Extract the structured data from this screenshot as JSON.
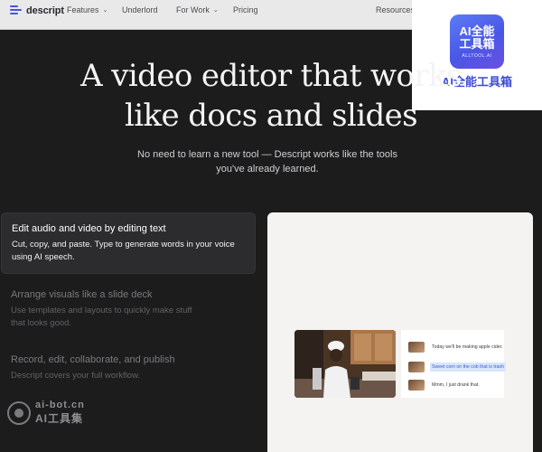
{
  "navbar": {
    "logo_text": "descript",
    "items": [
      {
        "label": "Features",
        "has_dropdown": true
      },
      {
        "label": "Underlord",
        "has_dropdown": false
      },
      {
        "label": "For Work",
        "has_dropdown": true
      },
      {
        "label": "Pricing",
        "has_dropdown": false
      },
      {
        "label": "Resources",
        "has_dropdown": false
      }
    ]
  },
  "hero": {
    "title_line1": "A video editor that works",
    "title_line2": "like docs and slides",
    "subtitle_line1": "No need to learn a new tool — Descript works like the tools",
    "subtitle_line2": "you've already learned."
  },
  "features": [
    {
      "title": "Edit audio and video by editing text",
      "desc_line1": "Cut, copy, and paste. Type to generate words in your voice",
      "desc_line2": "using AI speech.",
      "active": true
    },
    {
      "title": "Arrange visuals like a slide deck",
      "desc_line1": "Use templates and layouts to quickly make stuff",
      "desc_line2": "that looks good.",
      "active": false
    },
    {
      "title": "Record, edit, collaborate, and publish",
      "desc_line1": "Descript covers your full workflow.",
      "desc_line2": "",
      "active": false
    }
  ],
  "preview": {
    "script_lines": [
      {
        "text": "Today we'll be making apple cider.",
        "highlighted": false
      },
      {
        "text": "Sweet corn on the cob that is trash",
        "highlighted": true
      },
      {
        "text": "Mmm, I just drank that.",
        "highlighted": false
      }
    ]
  },
  "badge": {
    "tile_text": "AI全能工具箱",
    "tile_subtext": "ALLTOOL.AI",
    "caption": "AI全能工具箱"
  },
  "watermark": {
    "line1": "ai-bot.cn",
    "line2": "AI工具集"
  },
  "colors": {
    "background": "#1c1c1d",
    "navbar": "#e9e9ea",
    "accent": "#4a56d8",
    "highlight": "#d8e6ff"
  }
}
